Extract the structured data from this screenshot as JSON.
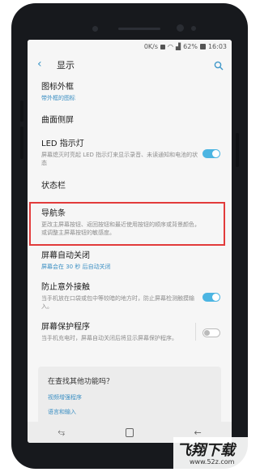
{
  "status_bar": {
    "net_speed": "0K/s",
    "battery": "62%",
    "time": "16:03"
  },
  "header": {
    "title": "显示"
  },
  "settings": [
    {
      "title": "图标外框",
      "subtitle": "带外框的图标",
      "subtitle_color": "blue"
    },
    {
      "title": "曲面侧屏"
    },
    {
      "title": "LED 指示灯",
      "subtitle": "屏幕熄灭时亮起 LED 指示灯来显示录音、未读通知和电池的状态",
      "toggle": "on"
    },
    {
      "title": "状态栏"
    },
    {
      "title": "导航条",
      "subtitle": "更改主屏幕按钮、返回按钮和最近使用按钮的顺序或背景颜色，或调整主屏幕按钮的敏感度。",
      "highlighted": true
    },
    {
      "title": "屏幕自动关闭",
      "subtitle": "屏幕会在 30 秒 后自动关闭",
      "subtitle_color": "blue"
    },
    {
      "title": "防止意外接触",
      "subtitle": "当手机放在口袋或包中等较暗的地方时，防止屏幕检测触摸输入。",
      "toggle": "on"
    },
    {
      "title": "屏幕保护程序",
      "subtitle": "当手机充电时，屏幕自动关闭后将显示屏幕保护程序。",
      "toggle": "off"
    }
  ],
  "suggest": {
    "title": "在查找其他功能吗？",
    "links": [
      "视频增强程序",
      "语言和输入"
    ]
  },
  "watermark": {
    "logo": "飞翔下载",
    "url": "www.52z.com"
  },
  "colors": {
    "accent": "#3b8fc3",
    "toggle_on": "#4cb5e2",
    "highlight": "#e23b3b"
  }
}
